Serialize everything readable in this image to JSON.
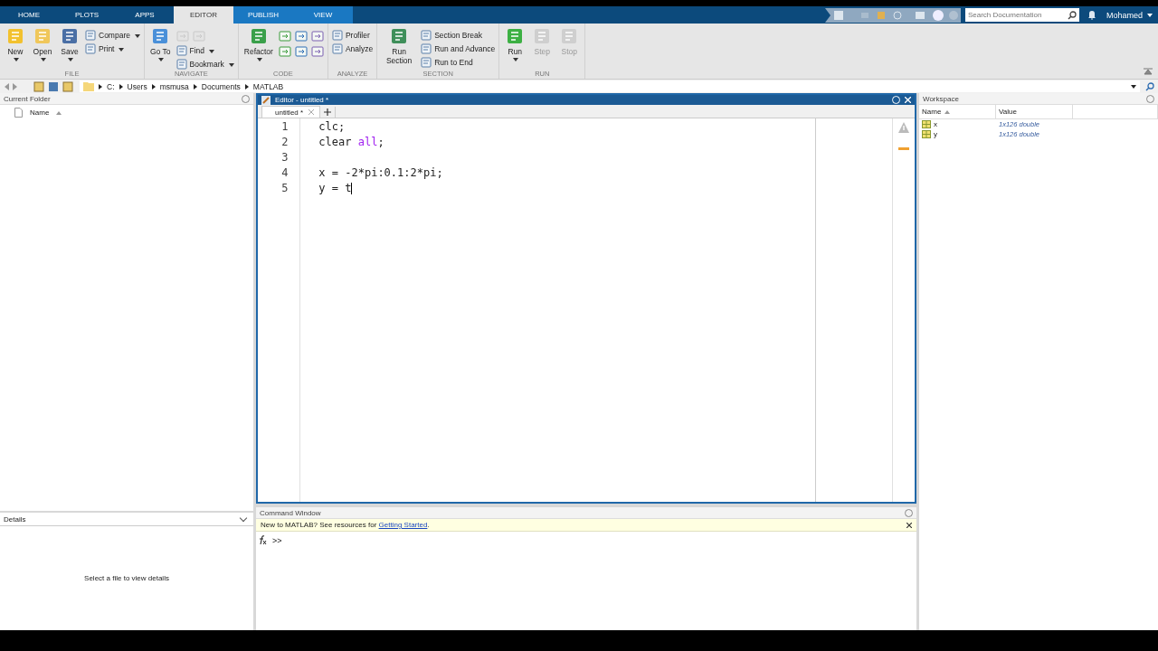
{
  "tabs": [
    {
      "label": "HOME",
      "selected": false
    },
    {
      "label": "PLOTS",
      "selected": false
    },
    {
      "label": "APPS",
      "selected": false
    },
    {
      "label": "EDITOR",
      "selected": true
    },
    {
      "label": "PUBLISH",
      "selected": false
    },
    {
      "label": "VIEW",
      "selected": false
    }
  ],
  "search": {
    "placeholder": "Search Documentation"
  },
  "user": {
    "name": "Mohamed"
  },
  "ribbon": [
    {
      "label": "FILE",
      "items": [
        {
          "kind": "large",
          "label": "New",
          "menu": true,
          "disabled": false
        },
        {
          "kind": "large",
          "label": "Open",
          "menu": true,
          "disabled": false
        },
        {
          "kind": "large",
          "label": "Save",
          "menu": true,
          "disabled": false
        },
        {
          "kind": "stack",
          "rows": [
            [
              {
                "kind": "small",
                "label": "Compare",
                "menu": true,
                "disabled": false
              }
            ],
            [
              {
                "kind": "small",
                "label": "Print",
                "menu": true,
                "disabled": false
              }
            ]
          ]
        }
      ]
    },
    {
      "label": "NAVIGATE",
      "items": [
        {
          "kind": "large",
          "label": "Go To",
          "menu": true,
          "disabled": false
        },
        {
          "kind": "stack",
          "rows": [
            [
              {
                "kind": "icon",
                "disabled": true
              },
              {
                "kind": "icon",
                "disabled": true
              }
            ],
            [
              {
                "kind": "small",
                "label": "Find",
                "menu": true,
                "disabled": false
              }
            ],
            [
              {
                "kind": "small",
                "label": "Bookmark",
                "menu": true,
                "disabled": false
              }
            ]
          ]
        }
      ]
    },
    {
      "label": "CODE",
      "items": [
        {
          "kind": "large",
          "label": "Refactor",
          "menu": true,
          "disabled": false
        },
        {
          "kind": "stack",
          "rows": [
            [
              {
                "kind": "icon",
                "disabled": false
              },
              {
                "kind": "icon",
                "disabled": false
              },
              {
                "kind": "icon",
                "disabled": false
              }
            ],
            [
              {
                "kind": "icon",
                "disabled": false
              },
              {
                "kind": "icon",
                "disabled": false
              },
              {
                "kind": "icon",
                "disabled": false
              }
            ]
          ]
        }
      ]
    },
    {
      "label": "ANALYZE",
      "items": [
        {
          "kind": "stack",
          "rows": [
            [
              {
                "kind": "small",
                "label": "Profiler",
                "menu": false,
                "disabled": false
              }
            ],
            [
              {
                "kind": "small",
                "label": "Analyze",
                "menu": false,
                "disabled": false
              }
            ]
          ]
        }
      ]
    },
    {
      "label": "SECTION",
      "items": [
        {
          "kind": "large",
          "label": "Run Section",
          "menu": false,
          "disabled": false
        },
        {
          "kind": "stack",
          "rows": [
            [
              {
                "kind": "small",
                "label": "Section Break",
                "menu": false,
                "disabled": false
              }
            ],
            [
              {
                "kind": "small",
                "label": "Run and Advance",
                "menu": false,
                "disabled": false
              }
            ],
            [
              {
                "kind": "small",
                "label": "Run to End",
                "menu": false,
                "disabled": false
              }
            ]
          ]
        }
      ]
    },
    {
      "label": "RUN",
      "items": [
        {
          "kind": "large",
          "label": "Run",
          "menu": true,
          "disabled": false
        },
        {
          "kind": "large",
          "label": "Step",
          "menu": false,
          "disabled": true
        },
        {
          "kind": "large",
          "label": "Stop",
          "menu": false,
          "disabled": true
        }
      ]
    }
  ],
  "path": [
    "C:",
    "Users",
    "msmusa",
    "Documents",
    "MATLAB"
  ],
  "current_folder": {
    "title": "Current Folder",
    "column": "Name"
  },
  "details": {
    "title": "Details",
    "message": "Select a file to view details"
  },
  "editor": {
    "title": "Editor - untitled *",
    "tabs": [
      {
        "label": "untitled *",
        "selected": true
      }
    ],
    "lines": [
      {
        "number": "1",
        "tokens": [
          {
            "text": "clc;",
            "kind": "plain"
          }
        ]
      },
      {
        "number": "2",
        "tokens": [
          {
            "text": "clear ",
            "kind": "plain"
          },
          {
            "text": "all",
            "kind": "string"
          },
          {
            "text": ";",
            "kind": "plain"
          }
        ]
      },
      {
        "number": "3"
      },
      {
        "number": "4",
        "tokens": [
          {
            "text": "x = -2*pi:0.1:2*pi;",
            "kind": "plain"
          }
        ]
      },
      {
        "number": "5",
        "tokens": [
          {
            "text": "y = t",
            "kind": "plain"
          }
        ]
      }
    ]
  },
  "command_window": {
    "title": "Command Window",
    "notice": "New to MATLAB? See resources for ",
    "link": "Getting Started",
    "notice_end": ".",
    "prompt": ">>"
  },
  "workspace": {
    "title": "Workspace",
    "columns": [
      "Name",
      "Value"
    ],
    "rows": [
      {
        "name": "x",
        "value": "1x126 double"
      },
      {
        "name": "y",
        "value": "1x126 double"
      }
    ]
  }
}
